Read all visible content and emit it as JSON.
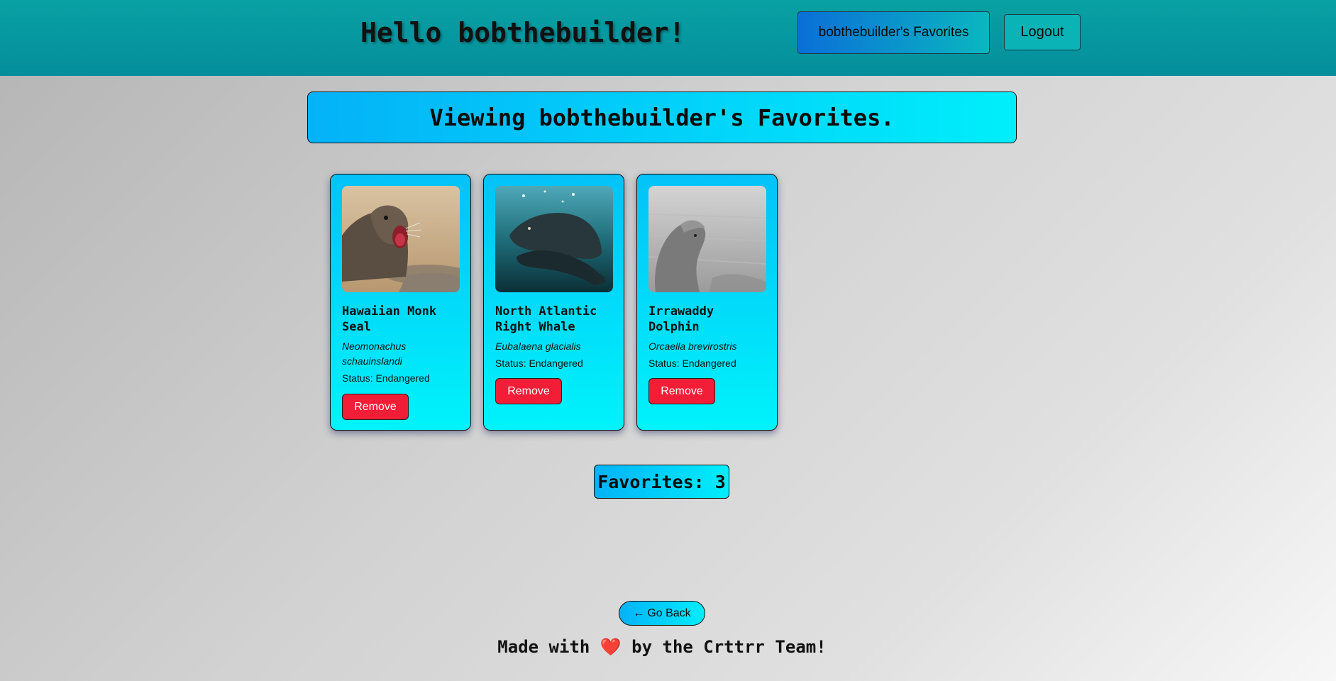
{
  "header": {
    "greeting": "Hello bobthebuilder!",
    "favorites_button": "bobthebuilder's Favorites",
    "logout_button": "Logout"
  },
  "banner": {
    "title": "Viewing bobthebuilder's Favorites."
  },
  "cards": [
    {
      "name": "Hawaiian Monk Seal",
      "scientific_name": "Neomonachus schauinslandi",
      "status": "Status: Endangered",
      "remove_label": "Remove",
      "image_icon": "monk-seal-photo"
    },
    {
      "name": "North Atlantic Right Whale",
      "scientific_name": "Eubalaena glacialis",
      "status": "Status: Endangered",
      "remove_label": "Remove",
      "image_icon": "right-whale-photo"
    },
    {
      "name": "Irrawaddy Dolphin",
      "scientific_name": "Orcaella brevirostris",
      "status": "Status: Endangered",
      "remove_label": "Remove",
      "image_icon": "dolphin-photo"
    }
  ],
  "favorites_count": "Favorites: 3",
  "go_back": {
    "arrow": "←",
    "label": "Go Back"
  },
  "footer": {
    "before": "Made with",
    "heart": "❤️",
    "after": "by the Crttrr Team!"
  },
  "colors": {
    "topbar": "#0598a0",
    "card_gradient_start": "#03c2f8",
    "card_gradient_end": "#00f3fb",
    "remove_button": "#f21d36",
    "heart": "#e0232f"
  }
}
